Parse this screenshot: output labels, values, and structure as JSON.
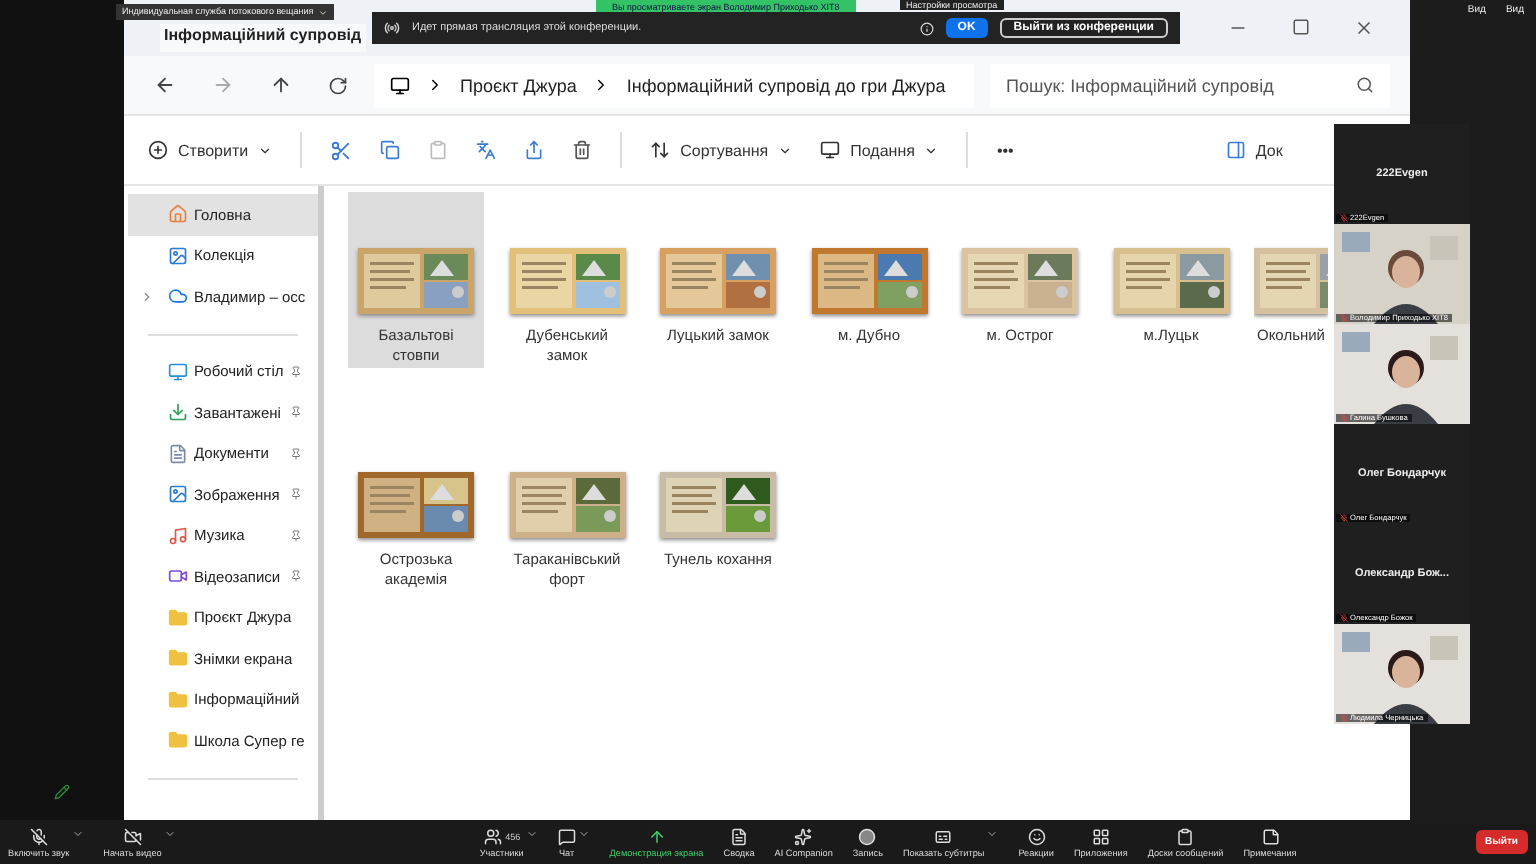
{
  "top_bar": {
    "stream_label": "Индивидуальная служба потокового вещания",
    "viewing_banner": "Вы просматриваете экран Володимир Приходько ХІТ8",
    "view_options": "Настройки просмотра",
    "view_buttons": [
      "Вид",
      "Вид"
    ]
  },
  "notice": {
    "text": "Идет прямая трансляция этой конференции.",
    "ok": "OK",
    "leave": "Выйти из конференции"
  },
  "explorer": {
    "tab_title": "Інформаційний супровід",
    "breadcrumbs": [
      "Проєкт Джура",
      "Інформаційний супровід до гри Джура"
    ],
    "search": {
      "placeholder": "Пошук: Інформаційний супровід"
    },
    "toolbar": {
      "create": "Створити",
      "sort": "Сортування",
      "view": "Подання",
      "more": "•••",
      "details": "Док"
    },
    "sidebar": [
      {
        "label": "Головна",
        "selected": true,
        "pinned": false
      },
      {
        "label": "Колекція",
        "selected": false,
        "pinned": false
      },
      {
        "label": "Владимир – осс",
        "selected": false,
        "pinned": false,
        "expanded": false
      },
      {
        "label": "Робочий стіл",
        "selected": false,
        "pinned": true
      },
      {
        "label": "Завантажені",
        "selected": false,
        "pinned": true
      },
      {
        "label": "Документи",
        "selected": false,
        "pinned": true
      },
      {
        "label": "Зображення",
        "selected": false,
        "pinned": true
      },
      {
        "label": "Музика",
        "selected": false,
        "pinned": true
      },
      {
        "label": "Відеозаписи",
        "selected": false,
        "pinned": true
      },
      {
        "label": "Проєкт Джура",
        "selected": false,
        "pinned": false
      },
      {
        "label": "Знімки екрана",
        "selected": false,
        "pinned": false
      },
      {
        "label": "Інформаційний",
        "selected": false,
        "pinned": false
      },
      {
        "label": "Школа Супер ге",
        "selected": false,
        "pinned": false
      }
    ],
    "files": [
      {
        "name": "Базальтові стовпи",
        "selected": true
      },
      {
        "name": "Дубенський замок",
        "selected": false
      },
      {
        "name": "Луцький замок",
        "selected": false
      },
      {
        "name": "м. Дубно",
        "selected": false
      },
      {
        "name": "м. Острог",
        "selected": false
      },
      {
        "name": "м.Луцьк",
        "selected": false
      },
      {
        "name": "Окольний",
        "selected": false
      },
      {
        "name": "Острозька академія",
        "selected": false
      },
      {
        "name": "Тараканівський форт",
        "selected": false
      },
      {
        "name": "Тунель кохання",
        "selected": false
      }
    ]
  },
  "participants": [
    {
      "kind": "name",
      "name": "222Evgen",
      "label": "222Evgen"
    },
    {
      "kind": "video",
      "label": "Володимир Приходько ХІТ8"
    },
    {
      "kind": "video",
      "label": "Галина Бушкова"
    },
    {
      "kind": "name",
      "name": "Олег Бондарчук",
      "label": "Олег Бондарчук"
    },
    {
      "kind": "name",
      "name": "Олександр Бож...",
      "label": "Олександр Божок"
    },
    {
      "kind": "video",
      "label": "Людмила Черницька"
    }
  ],
  "meeting_toolbar": [
    {
      "kind": "mic",
      "label": "Включить звук",
      "caret": true,
      "active": false
    },
    {
      "kind": "camera",
      "label": "Начать видео",
      "caret": true,
      "active": false
    },
    {
      "kind": "people",
      "label": "Участники",
      "count": "456",
      "caret": true,
      "active": false
    },
    {
      "kind": "chat",
      "label": "Чат",
      "caret": true,
      "active": false
    },
    {
      "kind": "share",
      "label": "Демонстрация экрана",
      "caret": false,
      "active": true
    },
    {
      "kind": "summary",
      "label": "Сводка",
      "caret": false,
      "active": false
    },
    {
      "kind": "ai",
      "label": "AI Companion",
      "caret": false,
      "active": false
    },
    {
      "kind": "record",
      "label": "Запись",
      "caret": false,
      "active": false
    },
    {
      "kind": "captions",
      "label": "Показать субтитры",
      "caret": true,
      "active": false
    },
    {
      "kind": "reactions",
      "label": "Реакции",
      "caret": false,
      "active": false
    },
    {
      "kind": "apps",
      "label": "Приложения",
      "caret": false,
      "active": false
    },
    {
      "kind": "board",
      "label": "Доски сообщений",
      "caret": false,
      "active": false
    },
    {
      "kind": "notes",
      "label": "Примечания",
      "caret": false,
      "active": false
    }
  ],
  "leave_button": "Выйти"
}
